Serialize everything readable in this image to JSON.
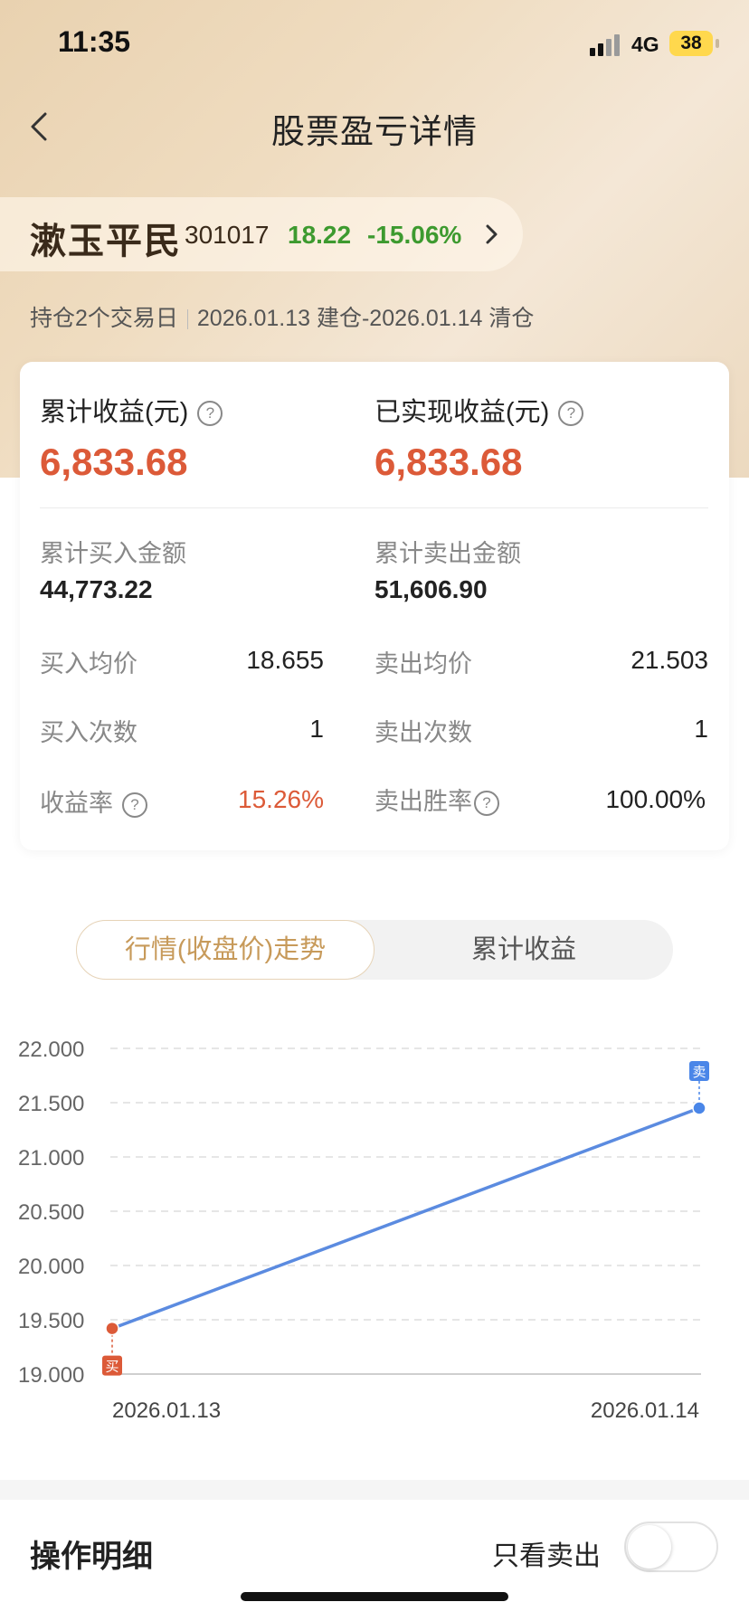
{
  "status_bar": {
    "time": "11:35",
    "network": "4G",
    "battery": "38"
  },
  "header": {
    "title": "股票盈亏详情"
  },
  "stock": {
    "name": "漱玉平民",
    "code": "301017",
    "price": "18.22",
    "change": "-15.06%"
  },
  "holding": {
    "days_text": "持仓2个交易日",
    "period_text": "2026.01.13 建仓-2026.01.14 清仓"
  },
  "summary": {
    "cumulative_label": "累计收益(元)",
    "cumulative_value": "6,833.68",
    "realized_label": "已实现收益(元)",
    "realized_value": "6,833.68",
    "buy_amount_label": "累计买入金额",
    "buy_amount_value": "44,773.22",
    "sell_amount_label": "累计卖出金额",
    "sell_amount_value": "51,606.90",
    "buy_avg_label": "买入均价",
    "buy_avg_value": "18.655",
    "sell_avg_label": "卖出均价",
    "sell_avg_value": "21.503",
    "buy_count_label": "买入次数",
    "buy_count_value": "1",
    "sell_count_label": "卖出次数",
    "sell_count_value": "1",
    "return_rate_label": "收益率",
    "return_rate_value": "15.26%",
    "win_rate_label": "卖出胜率",
    "win_rate_value": "100.00%"
  },
  "tabs": {
    "tab1": "行情(收盘价)走势",
    "tab2": "累计收益"
  },
  "chart_data": {
    "type": "line",
    "x": [
      "2026.01.13",
      "2026.01.14"
    ],
    "series": [
      {
        "values": [
          19.42,
          21.45
        ]
      }
    ],
    "yticks": [
      "22.000",
      "21.500",
      "21.000",
      "20.500",
      "20.000",
      "19.500",
      "19.000"
    ],
    "ylim": [
      19.0,
      22.0
    ],
    "grid": true,
    "markers": [
      {
        "x": "2026.01.13",
        "label": "买",
        "color": "#dc5a38"
      },
      {
        "x": "2026.01.14",
        "label": "卖",
        "color": "#4a86e8"
      }
    ],
    "line_color": "#5b8be0"
  },
  "operations": {
    "title": "操作明细",
    "only_sell_label": "只看卖出"
  }
}
